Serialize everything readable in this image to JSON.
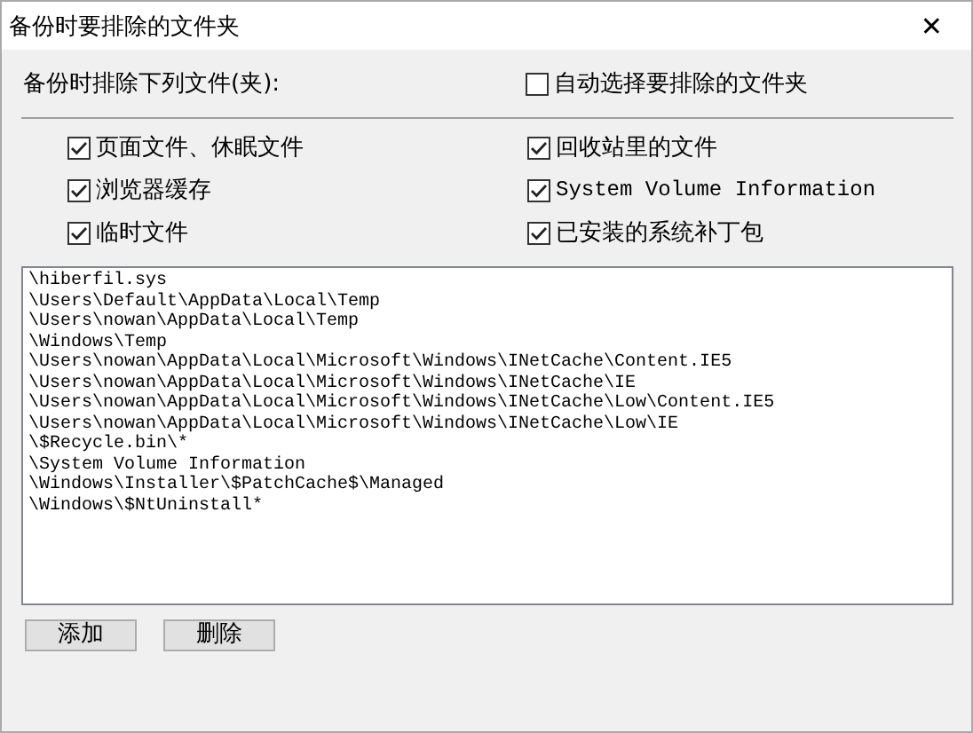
{
  "window": {
    "title": "备份时要排除的文件夹",
    "close": "✕"
  },
  "exclude_label": "备份时排除下列文件(夹):",
  "auto_select": {
    "label": "自动选择要排除的文件夹",
    "checked": false
  },
  "options": [
    {
      "label": "页面文件、休眠文件",
      "checked": true
    },
    {
      "label": "回收站里的文件",
      "checked": true
    },
    {
      "label": "浏览器缓存",
      "checked": true
    },
    {
      "label": "System Volume Information",
      "checked": true,
      "kind": "mono"
    },
    {
      "label": "临时文件",
      "checked": true
    },
    {
      "label": "已安装的系统补丁包",
      "checked": true
    }
  ],
  "paths": [
    "\\hiberfil.sys",
    "\\Users\\Default\\AppData\\Local\\Temp",
    "\\Users\\nowan\\AppData\\Local\\Temp",
    "\\Windows\\Temp",
    "\\Users\\nowan\\AppData\\Local\\Microsoft\\Windows\\INetCache\\Content.IE5",
    "\\Users\\nowan\\AppData\\Local\\Microsoft\\Windows\\INetCache\\IE",
    "\\Users\\nowan\\AppData\\Local\\Microsoft\\Windows\\INetCache\\Low\\Content.IE5",
    "\\Users\\nowan\\AppData\\Local\\Microsoft\\Windows\\INetCache\\Low\\IE",
    "\\$Recycle.bin\\*",
    "\\System Volume Information",
    "\\Windows\\Installer\\$PatchCache$\\Managed",
    "\\Windows\\$NtUninstall*"
  ],
  "buttons": [
    "添加",
    "删除"
  ]
}
